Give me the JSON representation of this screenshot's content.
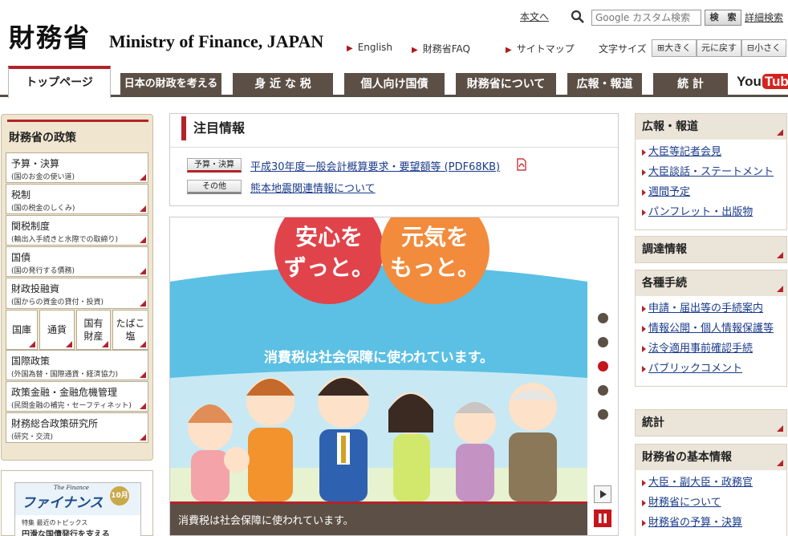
{
  "header": {
    "logo_jp": "財務省",
    "logo_en": "Ministry of Finance, JAPAN",
    "skip_link": "本文へ",
    "search_placeholder": "Google カスタム検索",
    "search_button": "検　索",
    "advanced_search": "詳細検索",
    "util_links": [
      "English",
      "財務省FAQ",
      "サイトマップ"
    ],
    "font_size_label": "文字サイズ",
    "font_buttons": [
      "大きく",
      "元に戻す",
      "小さく"
    ]
  },
  "global_nav": {
    "tabs": [
      "トップページ",
      "日本の財政を考える",
      "身 近 な 税",
      "個人向け国債",
      "財務省について",
      "広報・報道",
      "統 計"
    ],
    "youtube_you": "You",
    "youtube_tube": "Tube"
  },
  "left_sidebar": {
    "title": "財務省の政策",
    "items": [
      {
        "title": "予算・決算",
        "sub": "(国のお金の使い道)"
      },
      {
        "title": "税制",
        "sub": "(国の税金のしくみ)"
      },
      {
        "title": "関税制度",
        "sub": "(輸出入手続きと水際での取締り)"
      },
      {
        "title": "国債",
        "sub": "(国の発行する債務)"
      },
      {
        "title": "財政投融資",
        "sub": "(国からの資金の貸付・投資)"
      },
      {
        "title": "国際政策",
        "sub": "(外国為替・国際通貨・経済協力)"
      },
      {
        "title": "政策金融・金融危機管理",
        "sub": "(民間金融の補完・セーフティネット)"
      },
      {
        "title": "財務総合政策研究所",
        "sub": "(研究・交流)"
      }
    ],
    "small_items": [
      "国庫",
      "通貨",
      "国有\n財産",
      "たばこ\n塩"
    ]
  },
  "magazine": {
    "subtitle": "The Finance",
    "title": "ファイナンス",
    "badge": "10月",
    "line1": "特集 最近のトピックス",
    "line2": "円滑な国債発行を支える"
  },
  "notice": {
    "title": "注目情報",
    "items": [
      {
        "tag": "予算・決算",
        "text": "平成30年度一般会計概算要求・要望額等 (PDF68KB)"
      },
      {
        "tag": "その他",
        "text": "熊本地震関連情報について"
      }
    ]
  },
  "banner": {
    "circle_left": "安心を\nずっと。",
    "circle_right": "元気を\nもっと。",
    "message": "消費税は社会保障に使われています。",
    "caption": "消費税は社会保障に使われています。",
    "active_slide": 3,
    "slide_count": 5
  },
  "right_sidebar": {
    "sections": [
      {
        "title": "広報・報道",
        "links": [
          "大臣等記者会見",
          "大臣談話・ステートメント",
          "週間予定",
          "パンフレット・出版物"
        ]
      },
      {
        "title": "調達情報",
        "links": []
      },
      {
        "title": "各種手続",
        "links": [
          "申請・届出等の手続案内",
          "情報公開・個人情報保護等",
          "法令適用事前確認手続",
          "パブリックコメント"
        ]
      },
      {
        "title": "統計",
        "links": []
      },
      {
        "title": "財務省の基本情報",
        "links": [
          "大臣・副大臣・政務官",
          "財務省について",
          "財務省の予算・決算"
        ]
      }
    ]
  },
  "colors": {
    "accent_red": "#b3232a",
    "nav_brown": "#5c4f45",
    "sidebar_beige": "#f0e6cf",
    "link_blue": "#1a3b8c"
  }
}
